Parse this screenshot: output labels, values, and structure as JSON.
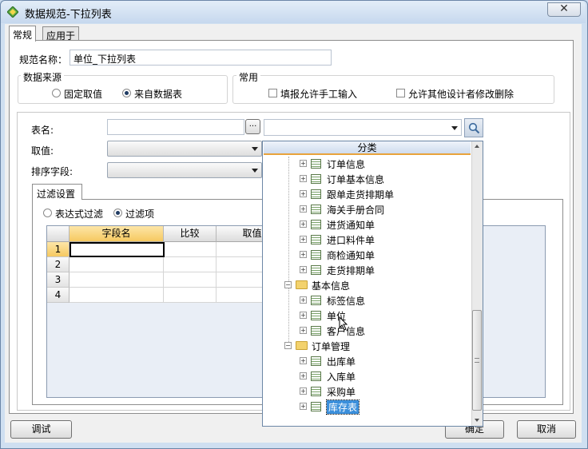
{
  "window": {
    "title": "数据规范-下拉列表",
    "close_glyph": "✕"
  },
  "tabs": [
    "常规",
    "应用于"
  ],
  "spec_name": {
    "label": "规范名称：",
    "value": "单位_下拉列表"
  },
  "data_source": {
    "title": "数据来源",
    "options": [
      "固定取值",
      "来自数据表"
    ],
    "selected": "来自数据表"
  },
  "common": {
    "title": "常用",
    "options": [
      "填报允许手工输入",
      "允许其他设计者修改删除"
    ]
  },
  "fields": {
    "table_label": "表名:",
    "ellipsis": "...",
    "value_label": "取值:",
    "sort_label": "排序字段:"
  },
  "filter": {
    "tab": "过滤设置",
    "options": [
      "表达式过滤",
      "过滤项"
    ],
    "selected": "过滤项",
    "columns": [
      "字段名",
      "比较",
      "取值"
    ],
    "rows": [
      "1",
      "2",
      "3",
      "4"
    ]
  },
  "buttons": {
    "debug": "调试",
    "ok": "确定",
    "cancel": "取消"
  },
  "dropdown": {
    "header": "分类",
    "items": [
      {
        "kind": "table",
        "text": "订单信息",
        "level": 2
      },
      {
        "kind": "table",
        "text": "订单基本信息",
        "level": 2
      },
      {
        "kind": "table",
        "text": "跟单走货排期单",
        "level": 2
      },
      {
        "kind": "table",
        "text": "海关手册合同",
        "level": 2
      },
      {
        "kind": "table",
        "text": "进货通知单",
        "level": 2
      },
      {
        "kind": "table",
        "text": "进口料件单",
        "level": 2
      },
      {
        "kind": "table",
        "text": "商检通知单",
        "level": 2
      },
      {
        "kind": "table",
        "text": "走货排期单",
        "level": 2
      },
      {
        "kind": "folder",
        "text": "基本信息",
        "level": 1
      },
      {
        "kind": "table",
        "text": "标签信息",
        "level": 2
      },
      {
        "kind": "table",
        "text": "单位",
        "level": 2
      },
      {
        "kind": "table",
        "text": "客户信息",
        "level": 2
      },
      {
        "kind": "folder",
        "text": "订单管理",
        "level": 1
      },
      {
        "kind": "table",
        "text": "出库单",
        "level": 2
      },
      {
        "kind": "table",
        "text": "入库单",
        "level": 2
      },
      {
        "kind": "table",
        "text": "采购单",
        "level": 2
      },
      {
        "kind": "table",
        "text": "库存表",
        "level": 2,
        "selected": true
      }
    ]
  },
  "colors": {
    "accent": "#e8a33c",
    "selection": "#3b8fdb",
    "title_bg": "#c6d8ee"
  }
}
